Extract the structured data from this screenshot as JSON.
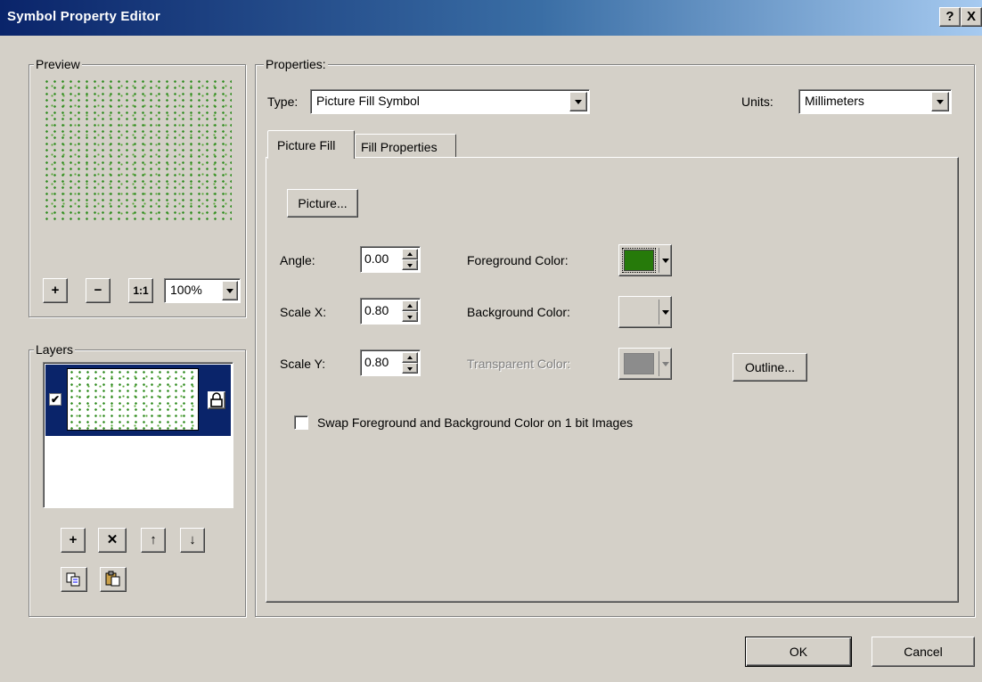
{
  "window": {
    "title": "Symbol Property Editor",
    "help_glyph": "?",
    "close_glyph": "X"
  },
  "preview": {
    "legend": "Preview",
    "zoom_in_glyph": "+",
    "zoom_out_glyph": "−",
    "actual_size_glyph": "1:1",
    "zoom_value": "100%"
  },
  "layers": {
    "legend": "Layers",
    "layer_checked": true,
    "add_glyph": "+",
    "remove_glyph": "✕",
    "up_glyph": "↑",
    "down_glyph": "↓"
  },
  "properties": {
    "legend": "Properties:",
    "type_label": "Type:",
    "type_value": "Picture Fill Symbol",
    "units_label": "Units:",
    "units_value": "Millimeters",
    "tabs": [
      "Picture Fill",
      "Fill Properties"
    ],
    "picture_button": "Picture...",
    "angle_label": "Angle:",
    "angle_value": "0.00",
    "scale_x_label": "Scale X:",
    "scale_x_value": "0.80",
    "scale_y_label": "Scale Y:",
    "scale_y_value": "0.80",
    "foreground_label": "Foreground Color:",
    "background_label": "Background Color:",
    "transparent_label": "Transparent Color:",
    "outline_button": "Outline...",
    "swap_label": "Swap Foreground and Background Color on 1 bit Images",
    "swap_checked": false
  },
  "footer": {
    "ok": "OK",
    "cancel": "Cancel"
  },
  "colors": {
    "foreground": "#267a0a",
    "background": "#d4d0c8",
    "transparent": "#8c8c8c",
    "pattern_green": "#2e8b1e",
    "layer_selection": "#0a246a"
  }
}
